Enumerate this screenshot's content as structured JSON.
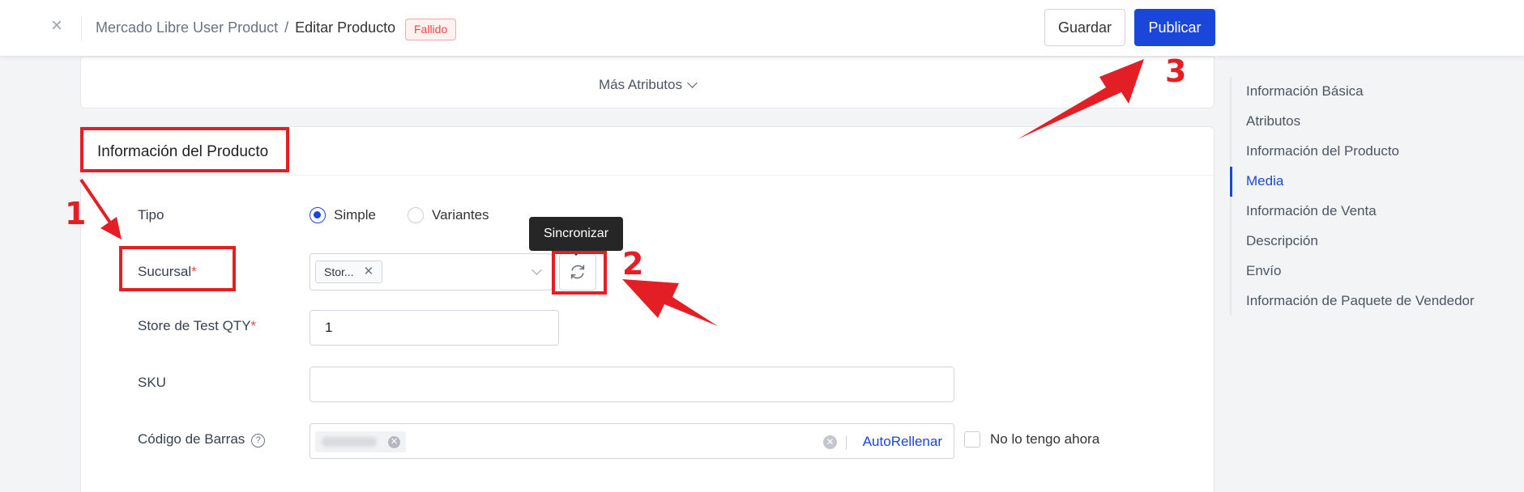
{
  "header": {
    "close_glyph": "×",
    "breadcrumb_parent": "Mercado Libre User Product",
    "breadcrumb_separator": "/",
    "breadcrumb_current": "Editar Producto",
    "status_badge": "Fallido",
    "save_label": "Guardar",
    "publish_label": "Publicar"
  },
  "attributes_card": {
    "more_attributes_label": "Más Atributos"
  },
  "product_card": {
    "title": "Información del Producto",
    "tipo_label": "Tipo",
    "tipo_options": [
      "Simple",
      "Variantes"
    ],
    "tipo_selected": "Simple",
    "sucursal_label": "Sucursal",
    "sucursal_tag": "Stor...",
    "sync_tooltip": "Sincronizar",
    "qty_label": "Store de Test QTY",
    "qty_value": "1",
    "sku_label": "SKU",
    "sku_value": "",
    "barcode_label": "Código de Barras",
    "autofill_label": "AutoRellenar",
    "no_barcode_label": "No lo tengo ahora",
    "required_mark": "*",
    "help_glyph": "?"
  },
  "side_nav": {
    "items": [
      "Información Básica",
      "Atributos",
      "Información del Producto",
      "Media",
      "Información de Venta",
      "Descripción",
      "Envío",
      "Información de Paquete de Vendedor"
    ],
    "active": "Media"
  },
  "annotations": {
    "step1": "1",
    "step2": "2",
    "step3": "3"
  },
  "colors": {
    "primary": "#1a47d9",
    "annotation_red": "#e31e24",
    "error_badge": "#e5484d"
  }
}
